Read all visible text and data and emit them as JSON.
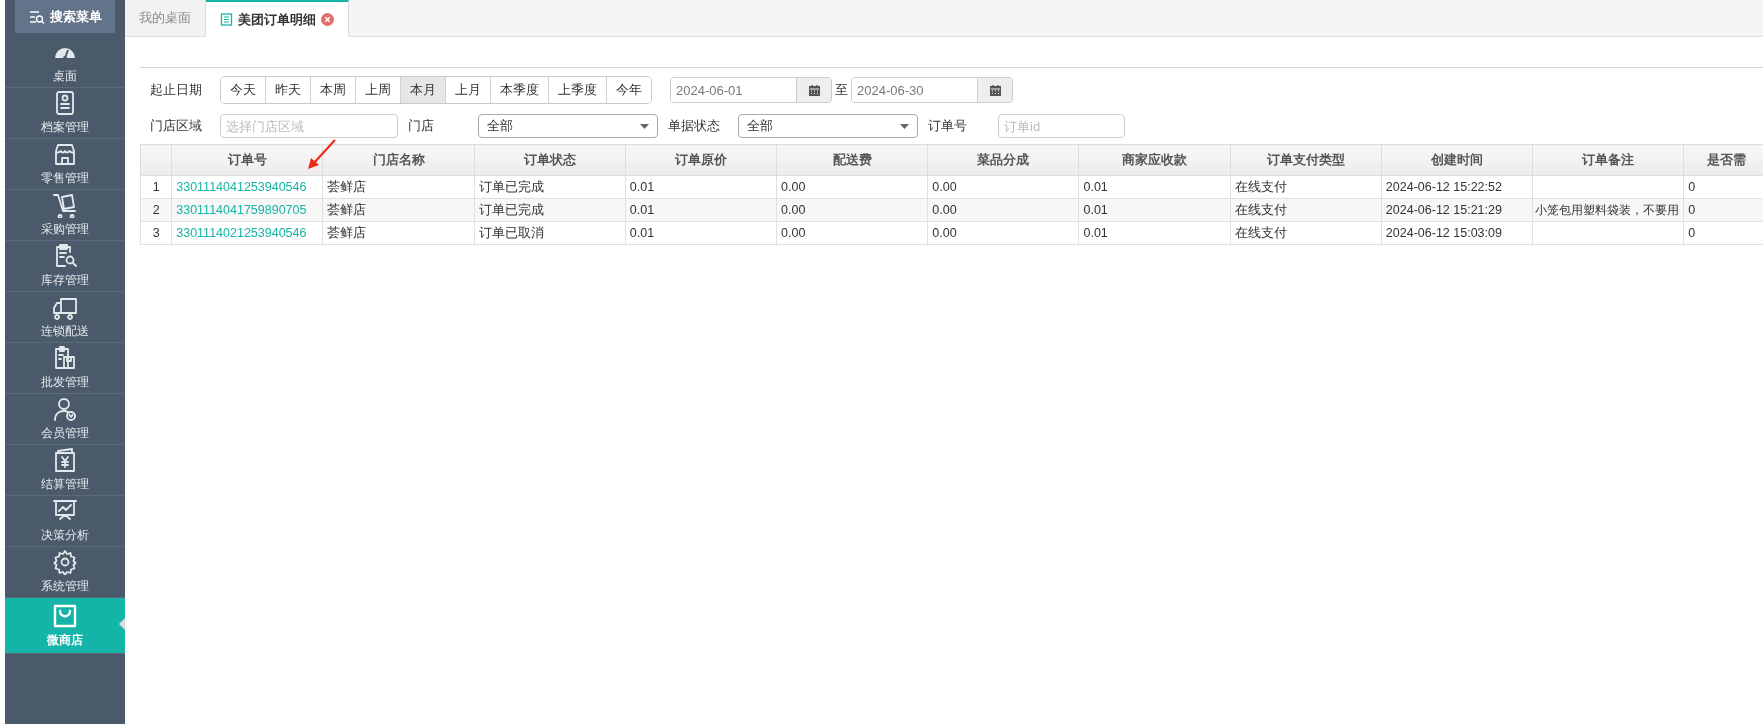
{
  "sidebar": {
    "search_button": "搜索菜单",
    "items": [
      {
        "label": "桌面",
        "selected": false
      },
      {
        "label": "档案管理",
        "selected": false
      },
      {
        "label": "零售管理",
        "selected": false
      },
      {
        "label": "采购管理",
        "selected": false
      },
      {
        "label": "库存管理",
        "selected": false
      },
      {
        "label": "连锁配送",
        "selected": false
      },
      {
        "label": "批发管理",
        "selected": false
      },
      {
        "label": "会员管理",
        "selected": false
      },
      {
        "label": "结算管理",
        "selected": false
      },
      {
        "label": "决策分析",
        "selected": false
      },
      {
        "label": "系统管理",
        "selected": false
      },
      {
        "label": "微商店",
        "selected": true
      }
    ]
  },
  "tabs": [
    {
      "label": "我的桌面",
      "selected": false,
      "closable": false
    },
    {
      "label": "美团订单明细",
      "selected": true,
      "closable": true
    }
  ],
  "filters": {
    "date_label": "起止日期",
    "quick_ranges": [
      {
        "label": "今天",
        "selected": false
      },
      {
        "label": "昨天",
        "selected": false
      },
      {
        "label": "本周",
        "selected": false
      },
      {
        "label": "上周",
        "selected": false
      },
      {
        "label": "本月",
        "selected": true
      },
      {
        "label": "上月",
        "selected": false
      },
      {
        "label": "本季度",
        "selected": false
      },
      {
        "label": "上季度",
        "selected": false
      },
      {
        "label": "今年",
        "selected": false
      }
    ],
    "start_date": "2024-06-01",
    "separator": "至",
    "end_date": "2024-06-30",
    "store_area": {
      "label": "门店区域",
      "placeholder": "选择门店区域"
    },
    "store": {
      "label": "门店",
      "value": "全部"
    },
    "doc_status": {
      "label": "单据状态",
      "value": "全部"
    },
    "order_no": {
      "label": "订单号",
      "placeholder": "订单id"
    }
  },
  "table": {
    "columns": [
      "订单号",
      "门店名称",
      "订单状态",
      "订单原价",
      "配送费",
      "菜品分成",
      "商家应收款",
      "订单支付类型",
      "创建时间",
      "订单备注",
      "是否需"
    ],
    "rows": [
      {
        "index": "1",
        "cells": [
          "3301114041253940546",
          "荟鲜店",
          "订单已完成",
          "0.01",
          "0.00",
          "0.00",
          "0.01",
          "在线支付",
          "2024-06-12 15:22:52",
          null,
          "0"
        ]
      },
      {
        "index": "2",
        "cells": [
          "3301114041759890705",
          "荟鲜店",
          "订单已完成",
          "0.01",
          "0.00",
          "0.00",
          "0.01",
          "在线支付",
          "2024-06-12 15:21:29",
          "小笼包用塑料袋装，不要用",
          "0"
        ]
      },
      {
        "index": "3",
        "cells": [
          "3301114021253940546",
          "荟鲜店",
          "订单已取消",
          "0.01",
          "0.00",
          "0.00",
          "0.01",
          "在线支付",
          "2024-06-12 15:03:09",
          null,
          "0"
        ]
      }
    ]
  }
}
